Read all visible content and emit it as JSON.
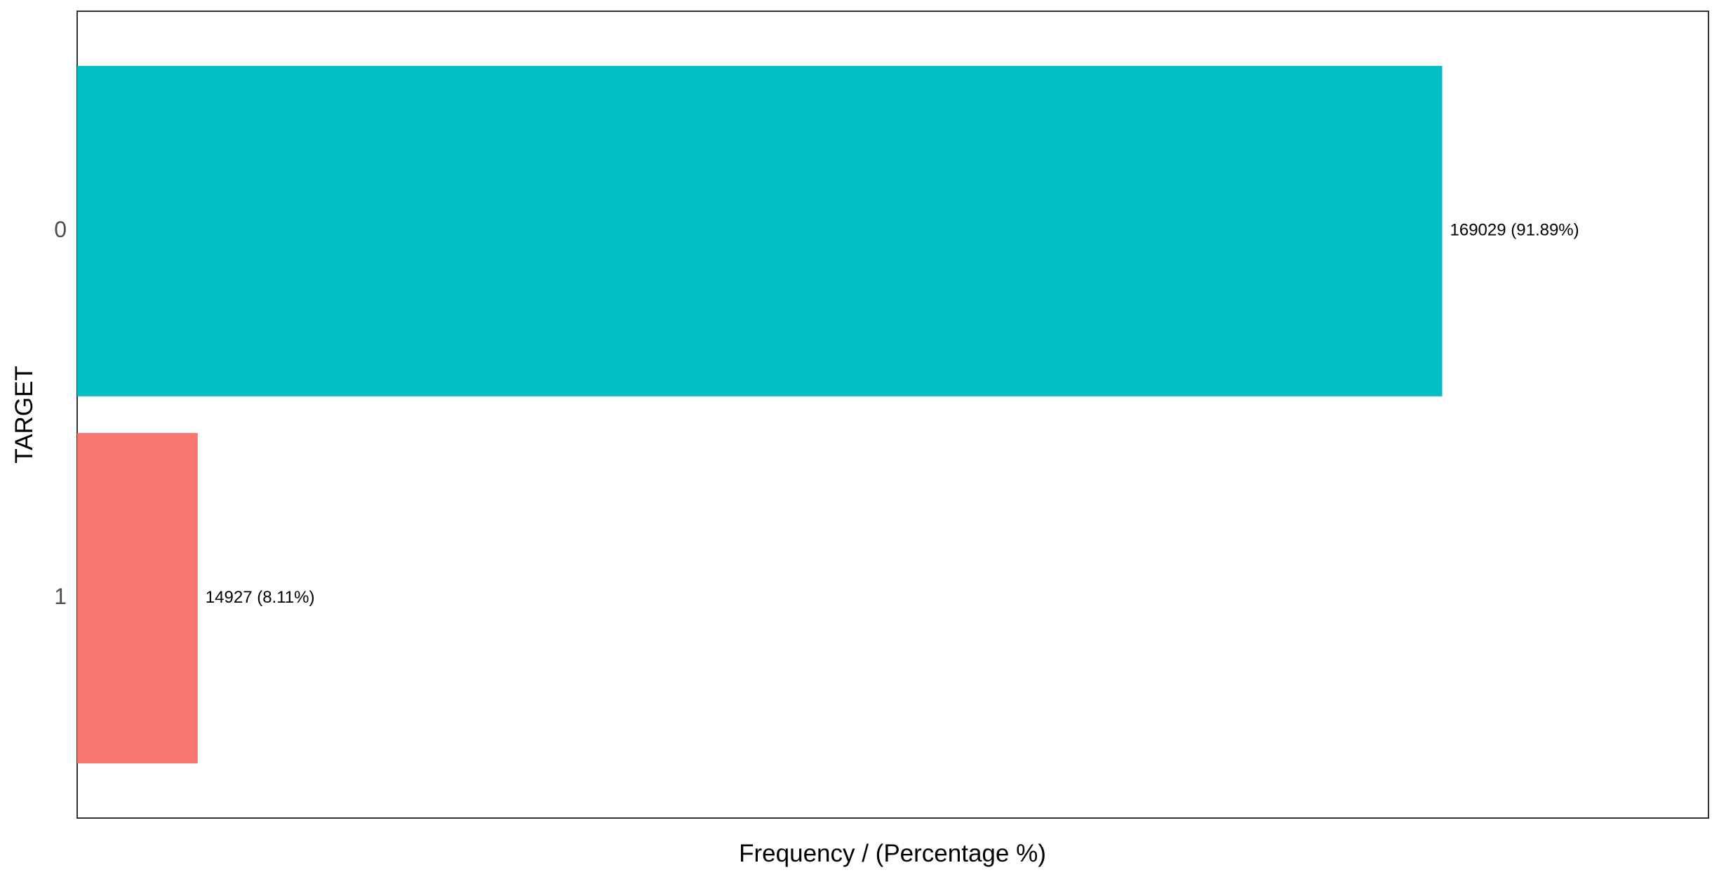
{
  "chart_data": {
    "type": "bar",
    "orientation": "horizontal",
    "categories": [
      "0",
      "1"
    ],
    "values": [
      169029,
      14927
    ],
    "percentages": [
      91.89,
      8.11
    ],
    "data_labels": [
      "169029 (91.89%)",
      "14927 (8.11%)"
    ],
    "colors": [
      "#00BFC4",
      "#F8766D"
    ],
    "title": "",
    "xlabel": "Frequency / (Percentage %)",
    "ylabel": "TARGET",
    "xlim": [
      0,
      202000
    ],
    "x_tick_labels_shown": false,
    "grid": false,
    "legend": "none"
  },
  "colors": {
    "panel_border": "#333333",
    "background": "#ffffff"
  }
}
